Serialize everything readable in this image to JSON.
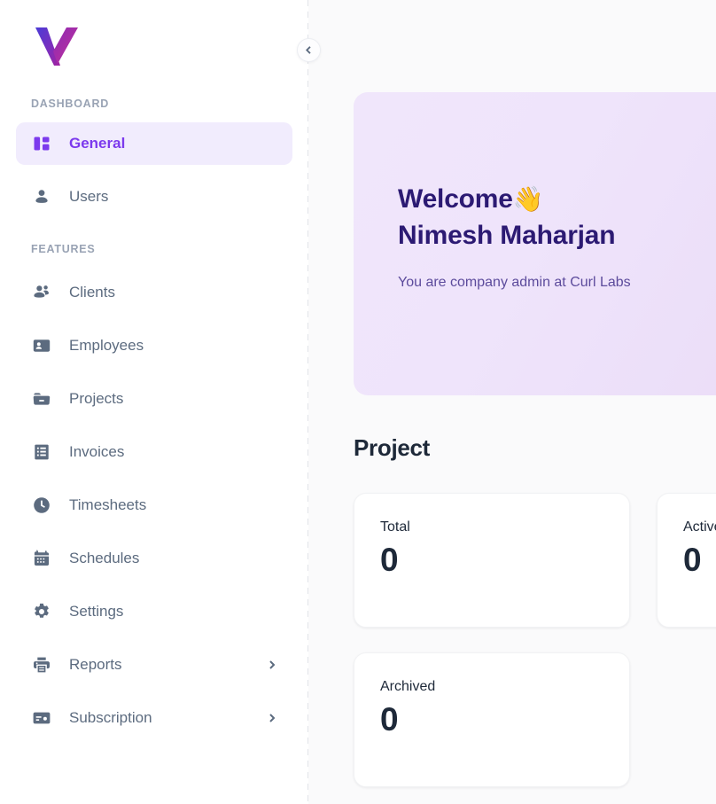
{
  "brand": {
    "logo_name": "v-logo",
    "accent": "#7c3aed",
    "gradient_start": "#4b3bd6",
    "gradient_end": "#c2309a"
  },
  "sidebar": {
    "collapse_label": "‹",
    "sections": [
      {
        "label": "DASHBOARD",
        "items": [
          {
            "label": "General",
            "icon": "dashboard-grid-icon",
            "active": true,
            "has_chevron": false
          },
          {
            "label": "Users",
            "icon": "user-icon",
            "active": false,
            "has_chevron": false
          }
        ]
      },
      {
        "label": "FEATURES",
        "items": [
          {
            "label": "Clients",
            "icon": "users-group-icon",
            "active": false,
            "has_chevron": false
          },
          {
            "label": "Employees",
            "icon": "id-badge-icon",
            "active": false,
            "has_chevron": false
          },
          {
            "label": "Projects",
            "icon": "folder-icon",
            "active": false,
            "has_chevron": false
          },
          {
            "label": "Invoices",
            "icon": "invoice-list-icon",
            "active": false,
            "has_chevron": false
          },
          {
            "label": "Timesheets",
            "icon": "clock-icon",
            "active": false,
            "has_chevron": false
          },
          {
            "label": "Schedules",
            "icon": "calendar-icon",
            "active": false,
            "has_chevron": false
          },
          {
            "label": "Settings",
            "icon": "gear-icon",
            "active": false,
            "has_chevron": false
          },
          {
            "label": "Reports",
            "icon": "printer-icon",
            "active": false,
            "has_chevron": true
          },
          {
            "label": "Subscription",
            "icon": "credit-card-icon",
            "active": false,
            "has_chevron": true
          }
        ]
      }
    ]
  },
  "welcome": {
    "greeting": "Welcome",
    "emoji": "👋",
    "user_name": "Nimesh Maharjan",
    "subtitle": "You are company admin at Curl Labs"
  },
  "project_section": {
    "heading": "Project",
    "stats": [
      {
        "label": "Total",
        "value": "0"
      },
      {
        "label": "Active",
        "value": "0"
      },
      {
        "label": "Archived",
        "value": "0"
      }
    ]
  }
}
